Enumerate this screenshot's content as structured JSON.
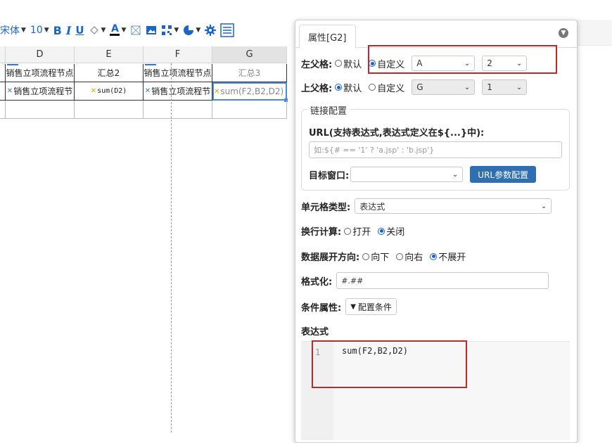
{
  "toolbar": {
    "font_name": "宋体",
    "font_size": "10",
    "bold": "B",
    "italic": "I",
    "underline": "U",
    "font_color": "A"
  },
  "sheet": {
    "columns": [
      "D",
      "E",
      "F",
      "G"
    ],
    "row1": {
      "D": "销售立项流程节点",
      "E": "汇总2",
      "F": "销售立项流程节点",
      "G": "汇总3"
    },
    "row2": {
      "D": "销售立项流程节",
      "E": "sum(D2)",
      "F": "销售立项流程节",
      "G": "sum(F2,B2,D2)"
    }
  },
  "panel": {
    "tab_title": "属性[G2]",
    "left_parent": {
      "label": "左父格:",
      "opt_default": "默认",
      "opt_custom": "自定义",
      "selected": "custom",
      "col_value": "A",
      "row_value": "2"
    },
    "top_parent": {
      "label": "上父格:",
      "opt_default": "默认",
      "opt_custom": "自定义",
      "selected": "default",
      "col_value": "G",
      "row_value": "1"
    },
    "link": {
      "legend": "链接配置",
      "url_label": "URL(支持表达式,表达式定义在${...}中):",
      "url_placeholder": "如:${# == '1' ? 'a.jsp' : 'b.jsp'}",
      "target_label": "目标窗口:",
      "target_value": "",
      "param_button": "URL参数配置"
    },
    "cell_type": {
      "label": "单元格类型:",
      "value": "表达式"
    },
    "wrap": {
      "label": "换行计算:",
      "opt_on": "打开",
      "opt_off": "关闭",
      "selected": "off"
    },
    "expand": {
      "label": "数据展开方向:",
      "opt_down": "向下",
      "opt_right": "向右",
      "opt_none": "不展开",
      "selected": "none"
    },
    "format": {
      "label": "格式化:",
      "value": "#.##"
    },
    "condition": {
      "label": "条件属性:",
      "button": "配置条件"
    },
    "expression": {
      "label": "表达式",
      "line_no": "1",
      "code": "sum(F2,B2,D2)"
    }
  },
  "colors": {
    "accent": "#1a66c8",
    "highlight": "#c0282f",
    "button": "#2f6fb0"
  }
}
